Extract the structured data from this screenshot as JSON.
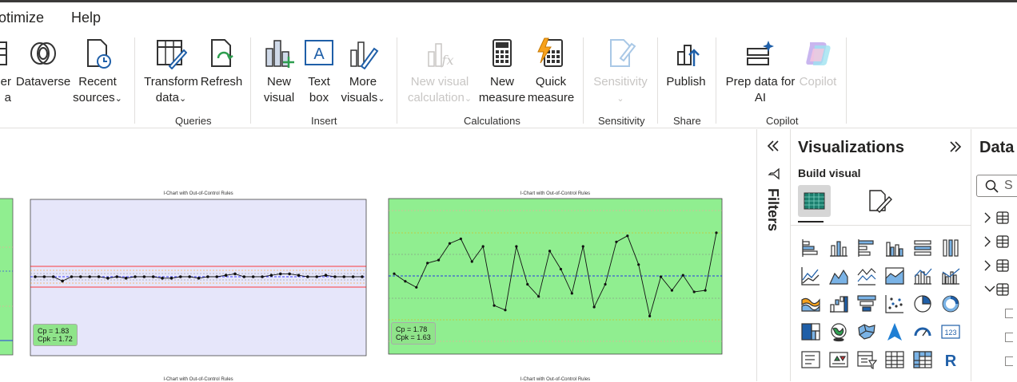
{
  "menubar": {
    "items": [
      "otimize",
      "Help"
    ]
  },
  "ribbon": {
    "buttons": {
      "partial_left": "er\na",
      "dataverse": "Dataverse",
      "recent_sources_1": "Recent",
      "recent_sources_2": "sources",
      "transform_data_1": "Transform",
      "transform_data_2": "data",
      "refresh": "Refresh",
      "new_visual_1": "New",
      "new_visual_2": "visual",
      "text_box_1": "Text",
      "text_box_2": "box",
      "more_visuals_1": "More",
      "more_visuals_2": "visuals",
      "new_visual_calc_1": "New visual",
      "new_visual_calc_2": "calculation",
      "new_measure_1": "New",
      "new_measure_2": "measure",
      "quick_measure_1": "Quick",
      "quick_measure_2": "measure",
      "sensitivity": "Sensitivity",
      "publish": "Publish",
      "prep_data_1": "Prep data for",
      "prep_data_2": "AI",
      "copilot": "Copilot"
    },
    "groups": {
      "queries": "Queries",
      "insert": "Insert",
      "calculations": "Calculations",
      "sensitivity": "Sensitivity",
      "share": "Share",
      "copilot": "Copilot"
    }
  },
  "charts": {
    "left_title": "I-Chart with Out-of-Control Rules",
    "left_cp": "Cp = 1.83",
    "left_cpk": "Cpk = 1.72",
    "right_title": "I-Chart with Out-of-Control Rules",
    "right_cp": "Cp = 1.78",
    "right_cpk": "Cpk = 1.63",
    "bottom_left_title": "I-Chart with Out-of-Control Rules",
    "bottom_right_title": "I-Chart with Out-of-Control Rules"
  },
  "chart_data": [
    {
      "type": "line",
      "title": "I-Chart with Out-of-Control Rules",
      "y_norm": [
        0.5,
        0.5,
        0.5,
        0.47,
        0.5,
        0.5,
        0.5,
        0.5,
        0.49,
        0.5,
        0.49,
        0.5,
        0.5,
        0.5,
        0.49,
        0.49,
        0.5,
        0.5,
        0.49,
        0.5,
        0.5,
        0.51,
        0.52,
        0.5,
        0.5,
        0.5,
        0.51,
        0.52,
        0.52,
        0.51,
        0.5,
        0.5,
        0.51,
        0.5,
        0.5,
        0.5,
        0.5
      ],
      "ylim": [
        0,
        1
      ]
    },
    {
      "type": "line",
      "title": "I-Chart with Out-of-Control Rules",
      "y_norm": [
        0.52,
        0.47,
        0.43,
        0.59,
        0.61,
        0.72,
        0.75,
        0.6,
        0.7,
        0.31,
        0.28,
        0.7,
        0.45,
        0.37,
        0.67,
        0.55,
        0.39,
        0.7,
        0.3,
        0.45,
        0.73,
        0.77,
        0.58,
        0.24,
        0.5,
        0.41,
        0.51,
        0.4,
        0.41,
        0.79
      ],
      "ylim": [
        0,
        1
      ]
    }
  ],
  "filters": {
    "label": "Filters"
  },
  "visualizations": {
    "title": "Visualizations",
    "build_visual": "Build visual",
    "r_label": "R",
    "num_label": "123"
  },
  "data_pane": {
    "title": "Data",
    "search_placeholder": "S"
  },
  "colors": {
    "green_bg": "#90ee90",
    "lavender_bg": "#e6e6fa",
    "accent": "#118dff",
    "blue_icon": "#1f5fa8",
    "ucl": "#ff0000",
    "center": "#0000ff"
  }
}
